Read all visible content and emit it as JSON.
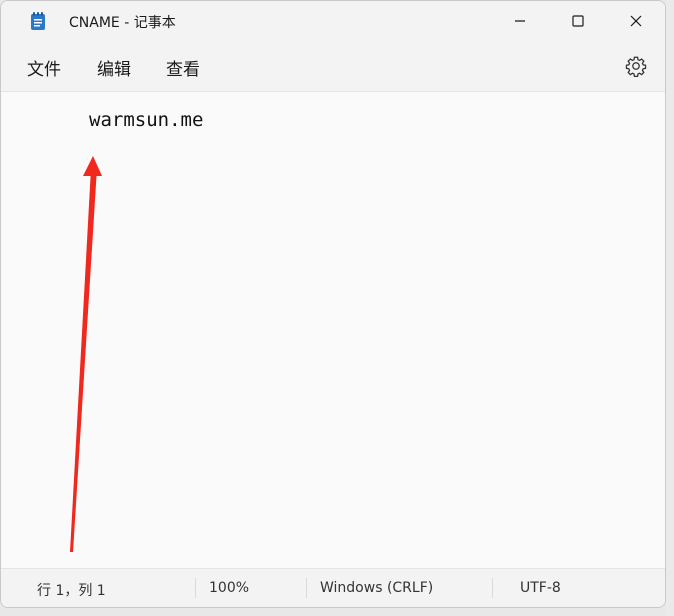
{
  "window": {
    "title": "CNAME - 记事本"
  },
  "menu": {
    "file": "文件",
    "edit": "编辑",
    "view": "查看"
  },
  "editor": {
    "content": "warmsun.me"
  },
  "status": {
    "position": "行 1，列 1",
    "zoom": "100%",
    "line_ending": "Windows (CRLF)",
    "encoding": "UTF-8"
  },
  "colors": {
    "annotation_arrow": "#f0281e",
    "app_icon": "#2b78c4"
  }
}
